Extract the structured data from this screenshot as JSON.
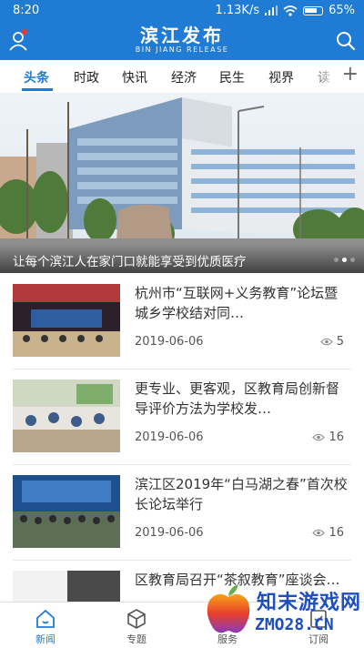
{
  "status_bar": {
    "time": "8:20",
    "network": "1.13K/s",
    "battery": "65%"
  },
  "header": {
    "title": "滨江发布",
    "subtitle": "BIN JIANG RELEASE"
  },
  "tabs": [
    "头条",
    "时政",
    "快讯",
    "经济",
    "民生",
    "视界",
    "读"
  ],
  "active_tab_index": 0,
  "banner": {
    "caption": "让每个滨江人在家门口就能享受到优质医疗",
    "slide_count": 3,
    "active_slide": 1
  },
  "news": [
    {
      "title": "杭州市“互联网+义务教育”论坛暨城乡学校结对同…",
      "date": "2019-06-06",
      "views": "5"
    },
    {
      "title": "更专业、更客观，区教育局创新督导评价方法为学校发…",
      "date": "2019-06-06",
      "views": "16"
    },
    {
      "title": "滨江区2019年“白马湖之春”首次校长论坛举行",
      "date": "2019-06-06",
      "views": "16"
    },
    {
      "title": "区教育局召开“茶叙教育”座谈会…",
      "date": "",
      "views": ""
    }
  ],
  "bottom_nav": [
    {
      "label": "新闻",
      "icon": "home-icon"
    },
    {
      "label": "专题",
      "icon": "cube-icon"
    },
    {
      "label": "服务",
      "icon": "grid-icon"
    },
    {
      "label": "订阅",
      "icon": "subscribe-icon"
    }
  ],
  "watermark": {
    "name": "知末游戏网",
    "url": "ZMO28.CN"
  },
  "colors": {
    "brand": "#1f7bd3",
    "text": "#333333",
    "muted": "#555555"
  }
}
